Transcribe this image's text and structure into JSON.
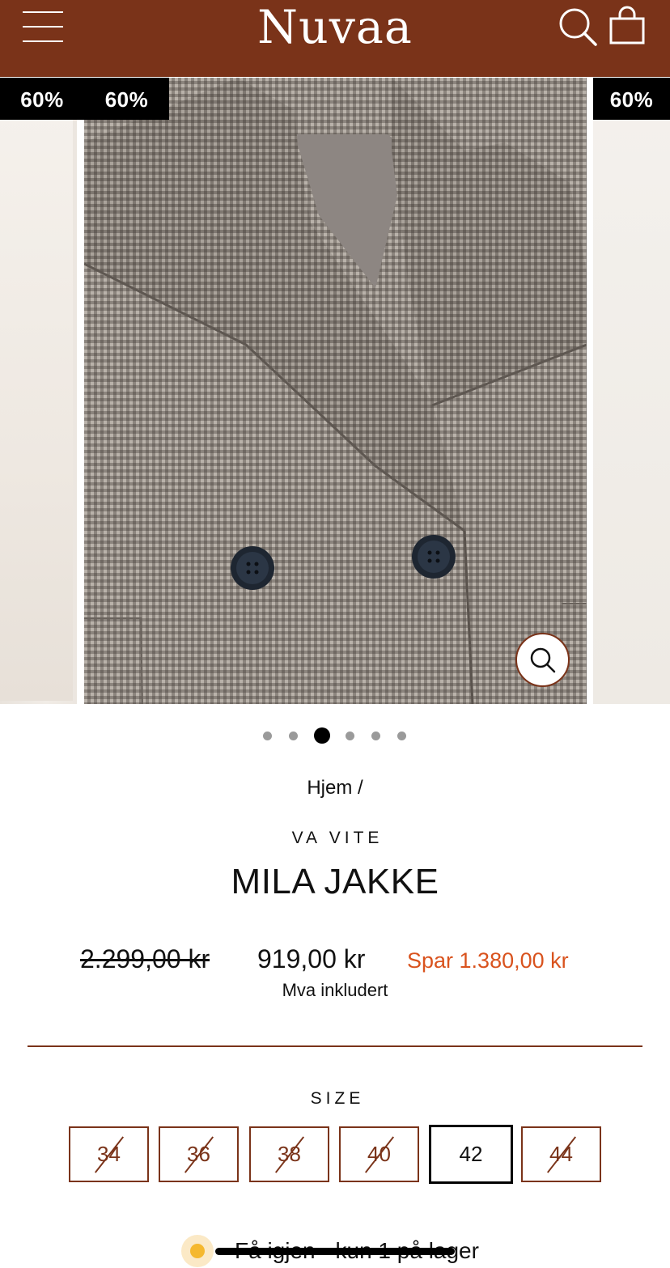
{
  "header": {
    "logo": "Nuvaa",
    "background_color": "#7a3319",
    "icons": [
      "menu-icon",
      "search-icon",
      "cart-icon"
    ]
  },
  "gallery": {
    "badges": [
      "60%",
      "60%",
      "60%"
    ],
    "dots_count": 6,
    "active_dot": 3,
    "zoom_icon": "zoom-icon"
  },
  "breadcrumb": {
    "home": "Hjem",
    "separator": "/"
  },
  "product": {
    "vendor": "VA VITE",
    "title": "MILA JAKKE",
    "compare_price": "2.299,00 kr",
    "price": "919,00 kr",
    "savings": "Spar 1.380,00 kr",
    "savings_color": "#d9531e",
    "vat_note": "Mva inkludert"
  },
  "sizes": {
    "label": "SIZE",
    "options": [
      {
        "value": "34",
        "available": false
      },
      {
        "value": "36",
        "available": false
      },
      {
        "value": "38",
        "available": false
      },
      {
        "value": "40",
        "available": false
      },
      {
        "value": "42",
        "available": true,
        "selected": true
      },
      {
        "value": "44",
        "available": false
      }
    ]
  },
  "stock": {
    "text": "Få igjen - kun 1 på lager",
    "indicator_color": "#f5b82e"
  }
}
